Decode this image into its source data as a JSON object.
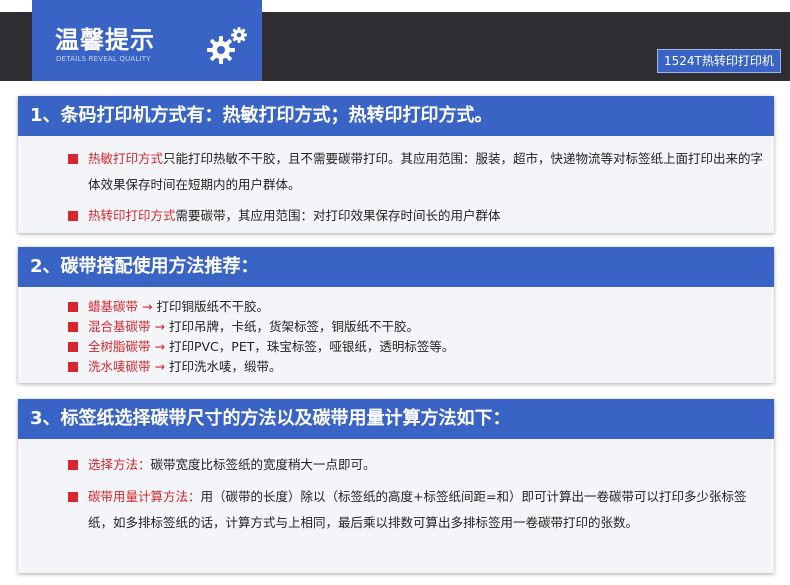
{
  "header": {
    "title": "温馨提示",
    "subtitle": "DETAILS REVEAL QUALITY",
    "model": "1524T热转印打印机",
    "icon": "gear-icon"
  },
  "colors": {
    "accent": "#3a63c6",
    "highlight": "#d7262d",
    "bar": "#2f2f33"
  },
  "sections": [
    {
      "heading": "1、条码打印机方式有：热敏打印方式；热转印打印方式。",
      "items": [
        {
          "label": "热敏打印方式",
          "text": "只能打印热敏不干胶，且不需要碳带打印。其应用范围：服装，超市，快递物流等对标签纸上面打印出来的字体效果保存时间在短期内的用户群体。"
        },
        {
          "label": "热转印打印方式",
          "text": "需要碳带，其应用范围：对打印效果保存时间长的用户群体"
        }
      ]
    },
    {
      "heading": "2、碳带搭配使用方法推荐：",
      "items": [
        {
          "label": "蜡基碳带",
          "arrow": "→",
          "text": "打印铜版纸不干胶。"
        },
        {
          "label": "混合基碳带",
          "arrow": "→",
          "text": "打印吊牌，卡纸，货架标签，铜版纸不干胶。"
        },
        {
          "label": "全树脂碳带",
          "arrow": "→",
          "text": "打印PVC，PET，珠宝标签，哑银纸，透明标签等。"
        },
        {
          "label": "洗水唛碳带",
          "arrow": "→",
          "text": "打印洗水唛，缎带。"
        }
      ]
    },
    {
      "heading": "3、标签纸选择碳带尺寸的方法以及碳带用量计算方法如下：",
      "items": [
        {
          "label": "选择方法：",
          "text": "碳带宽度比标签纸的宽度稍大一点即可。"
        },
        {
          "label": "碳带用量计算方法：",
          "text": "用（碳带的长度）除以（标签纸的高度+标签纸间距=和）即可计算出一卷碳带可以打印多少张标签纸，如多排标签纸的话，计算方式与上相同，最后乘以排数可算出多排标签用一卷碳带打印的张数。"
        }
      ]
    }
  ]
}
